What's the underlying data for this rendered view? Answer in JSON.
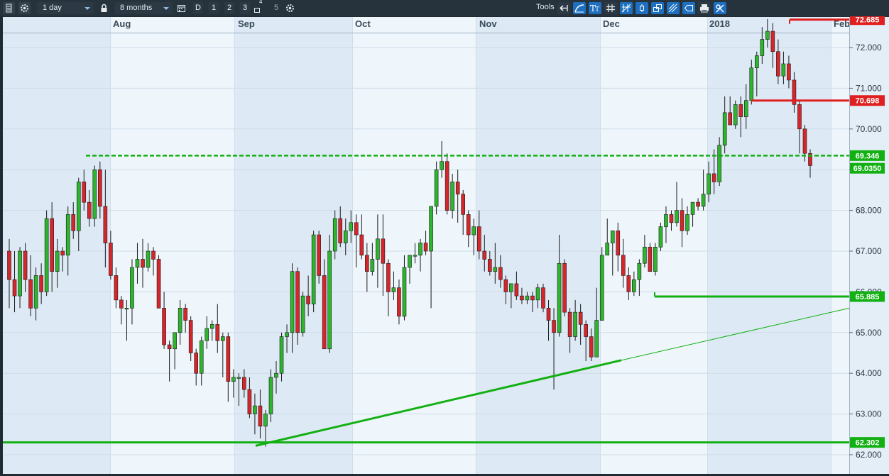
{
  "toolbar": {
    "interval": "1 day",
    "range": "8 months",
    "periods": [
      "D",
      "1",
      "2",
      "3",
      "4",
      "5"
    ],
    "tools_label": "Tools",
    "icons": [
      "menu-icon",
      "gear-icon",
      "lock-icon",
      "calendar-icon",
      "gear-icon",
      "back-arrow-icon",
      "curve-icon",
      "text-tool-icon",
      "grid-icon",
      "crosshair-icon",
      "candle-icon",
      "layers-icon",
      "fork-icon",
      "label-icon",
      "print-icon",
      "settings-toggle-icon"
    ]
  },
  "chart_data": {
    "type": "candlestick",
    "x_labels": [
      "Aug",
      "Sep",
      "Oct",
      "Nov",
      "Dec",
      "2018",
      "Feb"
    ],
    "ylim": [
      61.8,
      72.9
    ],
    "y_ticks": [
      "62.000",
      "63.000",
      "64.000",
      "65.000",
      "66.000",
      "67.000",
      "68.000",
      "69.000",
      "70.000",
      "71.000",
      "72.000"
    ],
    "colors": {
      "up": "#2db52d",
      "down": "#d7262b",
      "line_green": "#12b012",
      "line_red": "#e02020",
      "bg_light": "#eef5fb",
      "bg_dark": "#dde9f4",
      "grid": "#cfdde9"
    },
    "price_labels": [
      {
        "value": 72.685,
        "text": "72.685",
        "color": "#e02020"
      },
      {
        "value": 70.698,
        "text": "70.698",
        "color": "#e02020"
      },
      {
        "value": 69.346,
        "text": "69.346",
        "color": "#12b012"
      },
      {
        "value": 69.035,
        "text": "69.0350",
        "color": "#12b012"
      },
      {
        "value": 65.885,
        "text": "65.885",
        "color": "#12b012"
      },
      {
        "value": 62.302,
        "text": "62.302",
        "color": "#12b012"
      }
    ],
    "candles": [
      [
        67.0,
        67.3,
        65.6,
        66.3
      ],
      [
        66.3,
        67.0,
        65.5,
        65.9
      ],
      [
        65.9,
        67.1,
        65.6,
        67.0
      ],
      [
        67.0,
        67.2,
        66.0,
        66.3
      ],
      [
        66.3,
        66.9,
        65.4,
        65.6
      ],
      [
        65.6,
        66.6,
        65.3,
        66.4
      ],
      [
        66.4,
        66.7,
        65.7,
        66.0
      ],
      [
        66.0,
        68.0,
        65.9,
        67.8
      ],
      [
        67.8,
        68.2,
        66.0,
        66.5
      ],
      [
        66.5,
        67.3,
        66.1,
        67.0
      ],
      [
        67.0,
        67.1,
        66.5,
        66.9
      ],
      [
        66.9,
        68.1,
        66.4,
        67.9
      ],
      [
        67.9,
        68.2,
        67.3,
        67.5
      ],
      [
        67.5,
        68.8,
        67.0,
        68.7
      ],
      [
        68.7,
        69.0,
        68.0,
        68.2
      ],
      [
        68.2,
        68.5,
        67.6,
        67.8
      ],
      [
        67.8,
        69.1,
        67.6,
        69.0
      ],
      [
        69.0,
        69.2,
        67.8,
        68.1
      ],
      [
        68.1,
        69.0,
        66.6,
        67.2
      ],
      [
        67.2,
        67.5,
        66.3,
        66.4
      ],
      [
        66.4,
        66.6,
        65.6,
        65.8
      ],
      [
        65.8,
        65.9,
        65.2,
        65.6
      ],
      [
        65.6,
        65.8,
        64.8,
        65.6
      ],
      [
        65.6,
        66.8,
        65.2,
        66.6
      ],
      [
        66.6,
        67.2,
        66.2,
        66.8
      ],
      [
        66.8,
        67.3,
        66.1,
        66.6
      ],
      [
        66.6,
        67.2,
        66.5,
        67.0
      ],
      [
        67.0,
        67.1,
        66.4,
        66.8
      ],
      [
        66.8,
        66.9,
        65.9,
        65.6
      ],
      [
        65.6,
        66.0,
        64.6,
        64.7
      ],
      [
        64.7,
        64.8,
        63.8,
        64.6
      ],
      [
        64.6,
        65.0,
        64.1,
        65.0
      ],
      [
        65.0,
        65.8,
        64.7,
        65.6
      ],
      [
        65.6,
        65.7,
        65.0,
        65.3
      ],
      [
        65.3,
        65.4,
        64.3,
        64.5
      ],
      [
        64.5,
        64.6,
        63.7,
        64.0
      ],
      [
        64.0,
        64.9,
        63.7,
        64.8
      ],
      [
        64.8,
        65.4,
        64.6,
        65.1
      ],
      [
        65.1,
        65.3,
        64.8,
        65.2
      ],
      [
        65.2,
        65.7,
        64.5,
        64.8
      ],
      [
        64.8,
        65.0,
        63.9,
        64.9
      ],
      [
        64.9,
        65.0,
        63.3,
        63.8
      ],
      [
        63.8,
        64.1,
        63.4,
        63.9
      ],
      [
        63.9,
        64.0,
        63.2,
        63.9
      ],
      [
        63.9,
        64.1,
        63.4,
        63.6
      ],
      [
        63.6,
        63.9,
        62.9,
        63.0
      ],
      [
        63.0,
        63.5,
        62.5,
        63.2
      ],
      [
        63.2,
        63.6,
        62.4,
        62.7
      ],
      [
        62.7,
        63.1,
        62.2,
        63.0
      ],
      [
        63.0,
        64.1,
        62.8,
        63.9
      ],
      [
        63.9,
        64.3,
        63.5,
        64.0
      ],
      [
        64.0,
        65.0,
        63.8,
        64.9
      ],
      [
        64.9,
        65.2,
        64.5,
        65.0
      ],
      [
        65.0,
        66.7,
        64.5,
        66.5
      ],
      [
        66.5,
        66.6,
        64.7,
        65.0
      ],
      [
        65.0,
        66.0,
        64.9,
        65.9
      ],
      [
        65.9,
        66.4,
        65.4,
        65.7
      ],
      [
        65.7,
        67.5,
        65.5,
        67.4
      ],
      [
        67.4,
        67.5,
        66.2,
        66.4
      ],
      [
        66.4,
        66.8,
        64.8,
        64.6
      ],
      [
        64.6,
        67.4,
        64.5,
        67.0
      ],
      [
        67.0,
        68.0,
        66.8,
        67.8
      ],
      [
        67.8,
        68.1,
        67.1,
        67.2
      ],
      [
        67.2,
        67.8,
        66.9,
        67.5
      ],
      [
        67.5,
        68.0,
        67.2,
        67.7
      ],
      [
        67.7,
        67.9,
        66.6,
        67.4
      ],
      [
        67.4,
        67.9,
        66.8,
        66.9
      ],
      [
        66.9,
        67.2,
        66.0,
        66.5
      ],
      [
        66.5,
        67.2,
        66.4,
        66.8
      ],
      [
        66.8,
        67.9,
        66.1,
        67.3
      ],
      [
        67.3,
        67.9,
        65.9,
        66.7
      ],
      [
        66.7,
        66.8,
        65.4,
        66.0
      ],
      [
        66.0,
        66.5,
        65.8,
        66.1
      ],
      [
        66.1,
        66.3,
        65.2,
        65.4
      ],
      [
        65.4,
        66.9,
        65.3,
        66.6
      ],
      [
        66.6,
        66.8,
        66.2,
        66.9
      ],
      [
        66.9,
        67.2,
        66.7,
        66.9
      ],
      [
        66.9,
        67.3,
        66.5,
        67.2
      ],
      [
        67.2,
        67.5,
        66.9,
        67.0
      ],
      [
        67.0,
        68.0,
        65.6,
        68.1
      ],
      [
        68.1,
        69.2,
        67.9,
        69.0
      ],
      [
        69.0,
        69.7,
        68.8,
        69.2
      ],
      [
        69.2,
        69.4,
        67.9,
        68.0
      ],
      [
        68.0,
        68.9,
        67.8,
        68.7
      ],
      [
        68.7,
        69.0,
        67.7,
        68.4
      ],
      [
        68.4,
        68.5,
        67.4,
        67.9
      ],
      [
        67.9,
        68.0,
        67.1,
        67.4
      ],
      [
        67.4,
        67.8,
        66.9,
        67.6
      ],
      [
        67.6,
        68.0,
        66.8,
        67.0
      ],
      [
        67.0,
        67.4,
        66.5,
        66.8
      ],
      [
        66.8,
        67.0,
        66.4,
        66.5
      ],
      [
        66.5,
        67.2,
        66.2,
        66.6
      ],
      [
        66.6,
        66.9,
        66.1,
        66.3
      ],
      [
        66.3,
        66.4,
        65.7,
        66.0
      ],
      [
        66.0,
        66.2,
        65.6,
        66.2
      ],
      [
        66.2,
        66.5,
        65.8,
        65.9
      ],
      [
        65.9,
        66.1,
        65.7,
        65.8
      ],
      [
        65.8,
        66.0,
        65.7,
        65.9
      ],
      [
        65.9,
        66.0,
        65.5,
        65.8
      ],
      [
        65.8,
        66.2,
        65.6,
        66.1
      ],
      [
        66.1,
        66.2,
        65.5,
        65.6
      ],
      [
        65.6,
        65.8,
        64.8,
        65.3
      ],
      [
        65.3,
        65.6,
        63.6,
        65.0
      ],
      [
        65.0,
        67.4,
        64.9,
        66.7
      ],
      [
        66.7,
        66.8,
        65.4,
        65.5
      ],
      [
        65.5,
        65.6,
        64.5,
        64.9
      ],
      [
        64.9,
        65.8,
        64.8,
        65.5
      ],
      [
        65.5,
        65.7,
        64.7,
        65.2
      ],
      [
        65.2,
        65.3,
        64.3,
        64.9
      ],
      [
        64.9,
        65.1,
        64.3,
        64.4
      ],
      [
        64.4,
        66.1,
        65.2,
        65.3
      ],
      [
        65.3,
        67.1,
        65.3,
        66.9
      ],
      [
        66.9,
        67.8,
        67.0,
        67.2
      ],
      [
        67.2,
        67.4,
        66.4,
        67.5
      ],
      [
        67.5,
        67.7,
        66.5,
        66.9
      ],
      [
        66.9,
        67.3,
        66.1,
        66.4
      ],
      [
        66.4,
        66.6,
        65.8,
        66.0
      ],
      [
        66.0,
        66.5,
        65.9,
        66.3
      ],
      [
        66.3,
        66.8,
        65.9,
        66.7
      ],
      [
        66.7,
        67.4,
        66.6,
        67.1
      ],
      [
        67.1,
        67.2,
        66.8,
        66.5
      ],
      [
        66.5,
        67.2,
        66.4,
        67.1
      ],
      [
        67.1,
        67.7,
        67.0,
        67.6
      ],
      [
        67.6,
        68.1,
        67.2,
        67.9
      ],
      [
        67.9,
        68.0,
        67.5,
        67.7
      ],
      [
        67.7,
        68.7,
        67.6,
        68.0
      ],
      [
        68.0,
        68.3,
        67.1,
        67.5
      ],
      [
        67.5,
        68.1,
        67.4,
        67.9
      ],
      [
        67.9,
        68.2,
        67.6,
        68.2
      ],
      [
        68.2,
        68.3,
        68.0,
        68.1
      ],
      [
        68.1,
        69.0,
        68.0,
        68.4
      ],
      [
        68.4,
        69.2,
        68.2,
        68.9
      ],
      [
        68.9,
        69.5,
        68.4,
        68.7
      ],
      [
        68.7,
        69.8,
        68.6,
        69.6
      ],
      [
        69.6,
        70.8,
        69.4,
        70.4
      ],
      [
        70.4,
        70.8,
        70.3,
        70.1
      ],
      [
        70.1,
        70.7,
        70.0,
        70.6
      ],
      [
        70.6,
        70.8,
        69.8,
        70.3
      ],
      [
        70.3,
        71.1,
        70.0,
        70.7
      ],
      [
        70.7,
        71.7,
        70.6,
        71.5
      ],
      [
        71.5,
        71.9,
        70.8,
        71.8
      ],
      [
        71.8,
        72.5,
        71.6,
        72.2
      ],
      [
        72.2,
        72.7,
        72.0,
        72.4
      ],
      [
        72.4,
        72.6,
        71.5,
        71.9
      ],
      [
        71.9,
        72.2,
        71.1,
        71.3
      ],
      [
        71.3,
        71.9,
        71.1,
        71.6
      ],
      [
        71.6,
        71.8,
        71.0,
        71.2
      ],
      [
        71.2,
        71.4,
        70.4,
        70.6
      ],
      [
        70.6,
        70.7,
        69.4,
        70.0
      ],
      [
        70.0,
        70.1,
        69.2,
        69.4
      ],
      [
        69.4,
        69.5,
        68.8,
        69.1
      ]
    ]
  }
}
